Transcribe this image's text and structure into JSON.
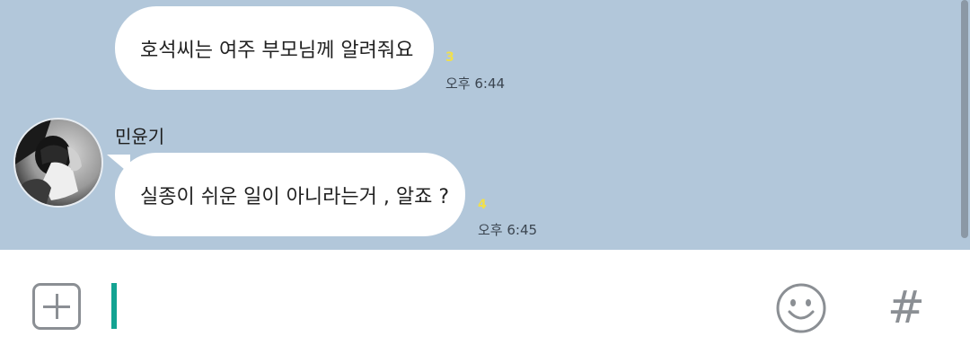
{
  "messages": [
    {
      "text": "호석씨는 여주 부모님께 알려줘요",
      "unread_count": "3",
      "time": "오후 6:44"
    },
    {
      "sender": "민윤기",
      "text": "실종이 쉬운 일이 아니라는거 , 알죠 ?",
      "unread_count": "4",
      "time": "오후 6:45",
      "avatar_icon": "profile-photo"
    }
  ],
  "input_bar": {
    "plus_icon": "plus-square-icon",
    "emoji_icon": "smiley-icon",
    "hash_label": "#"
  },
  "colors": {
    "chat_background": "#b2c7da",
    "bubble": "#ffffff",
    "unread": "#f1e04a",
    "cursor": "#13a392",
    "icon_gray": "#8b8f94"
  }
}
